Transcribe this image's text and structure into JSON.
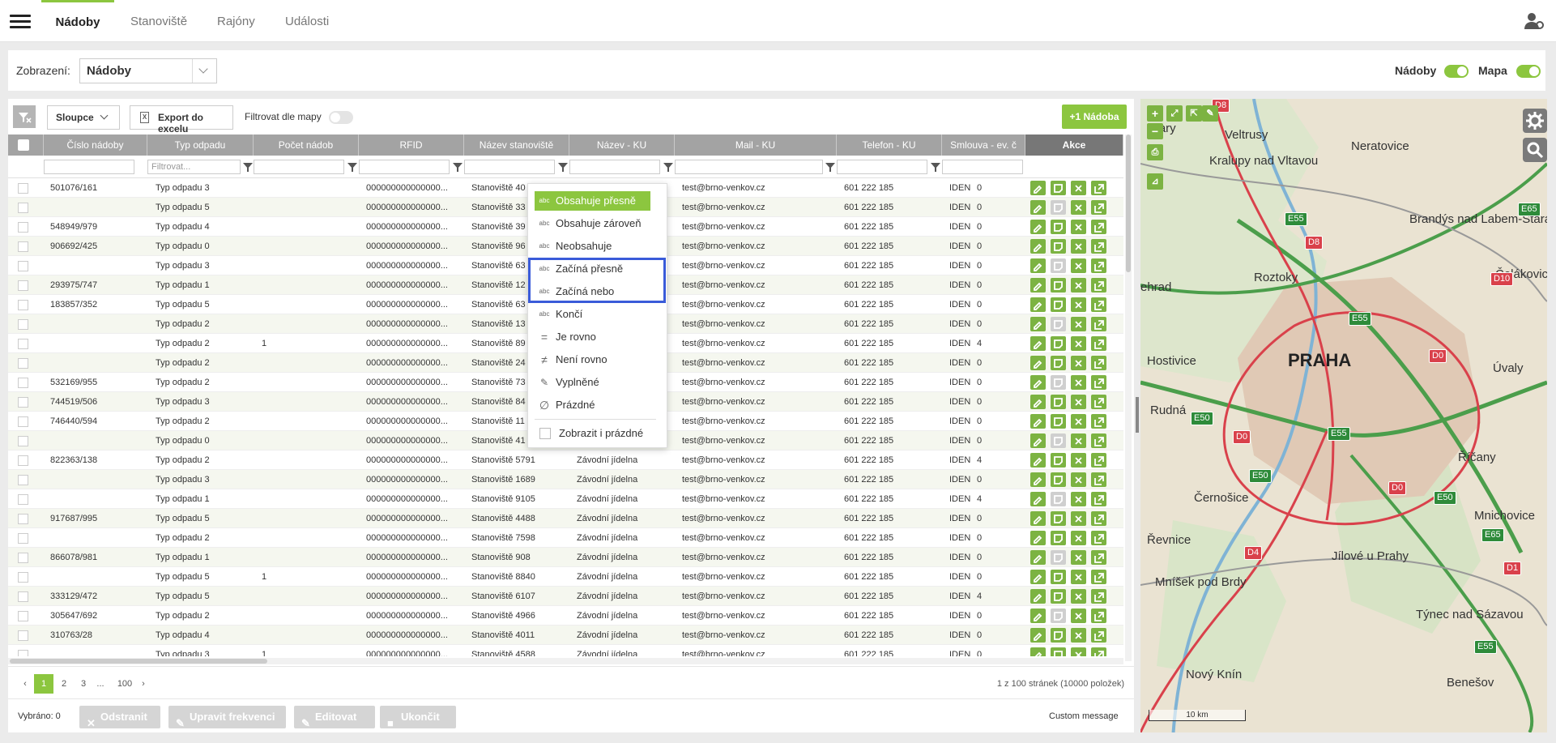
{
  "nav": {
    "tabs": [
      "Nádoby",
      "Stanoviště",
      "Rajóny",
      "Události"
    ]
  },
  "view": {
    "label": "Zobrazení:",
    "selected": "Nádoby",
    "toggle_nadoby": "Nádoby",
    "toggle_mapa": "Mapa"
  },
  "toolbar": {
    "columns": "Sloupce",
    "export": "Export do excelu",
    "filter_map": "Filtrovat dle mapy",
    "add": "+1 Nádoba"
  },
  "columns": [
    "Číslo nádoby",
    "Typ odpadu",
    "Počet nádob",
    "RFID",
    "Název stanoviště",
    "Název - KU",
    "Mail - KU",
    "Telefon - KU",
    "Smlouva - ev. č",
    "Akce"
  ],
  "filter_placeholder": "Filtrovat...",
  "rows": [
    {
      "cislo": "501076/161",
      "typ": "Typ odpadu 3",
      "pocet": "",
      "rfid": "000000000000000...",
      "stan": "Stanoviště 40",
      "ku": "",
      "mail": "test@brno-venkov.cz",
      "tel": "601 222 185",
      "sml": "IDEN",
      "n": "0"
    },
    {
      "cislo": "",
      "typ": "Typ odpadu 5",
      "pocet": "",
      "rfid": "000000000000000...",
      "stan": "Stanoviště 33",
      "ku": "",
      "mail": "test@brno-venkov.cz",
      "tel": "601 222 185",
      "sml": "IDEN",
      "n": "0"
    },
    {
      "cislo": "548949/979",
      "typ": "Typ odpadu 4",
      "pocet": "",
      "rfid": "000000000000000...",
      "stan": "Stanoviště 39",
      "ku": "",
      "mail": "test@brno-venkov.cz",
      "tel": "601 222 185",
      "sml": "IDEN",
      "n": "0"
    },
    {
      "cislo": "906692/425",
      "typ": "Typ odpadu 0",
      "pocet": "",
      "rfid": "000000000000000...",
      "stan": "Stanoviště 96",
      "ku": "",
      "mail": "test@brno-venkov.cz",
      "tel": "601 222 185",
      "sml": "IDEN",
      "n": "0"
    },
    {
      "cislo": "",
      "typ": "Typ odpadu 3",
      "pocet": "",
      "rfid": "000000000000000...",
      "stan": "Stanoviště 63",
      "ku": "",
      "mail": "test@brno-venkov.cz",
      "tel": "601 222 185",
      "sml": "IDEN",
      "n": "0"
    },
    {
      "cislo": "293975/747",
      "typ": "Typ odpadu 1",
      "pocet": "",
      "rfid": "000000000000000...",
      "stan": "Stanoviště 12",
      "ku": "",
      "mail": "test@brno-venkov.cz",
      "tel": "601 222 185",
      "sml": "IDEN",
      "n": "0"
    },
    {
      "cislo": "183857/352",
      "typ": "Typ odpadu 5",
      "pocet": "",
      "rfid": "000000000000000...",
      "stan": "Stanoviště 63",
      "ku": "",
      "mail": "test@brno-venkov.cz",
      "tel": "601 222 185",
      "sml": "IDEN",
      "n": "0"
    },
    {
      "cislo": "",
      "typ": "Typ odpadu 2",
      "pocet": "",
      "rfid": "000000000000000...",
      "stan": "Stanoviště 13",
      "ku": "",
      "mail": "test@brno-venkov.cz",
      "tel": "601 222 185",
      "sml": "IDEN",
      "n": "0"
    },
    {
      "cislo": "",
      "typ": "Typ odpadu 2",
      "pocet": "1",
      "rfid": "000000000000000...",
      "stan": "Stanoviště 89",
      "ku": "",
      "mail": "test@brno-venkov.cz",
      "tel": "601 222 185",
      "sml": "IDEN",
      "n": "4"
    },
    {
      "cislo": "",
      "typ": "Typ odpadu 2",
      "pocet": "",
      "rfid": "000000000000000...",
      "stan": "Stanoviště 24",
      "ku": "",
      "mail": "test@brno-venkov.cz",
      "tel": "601 222 185",
      "sml": "IDEN",
      "n": "0"
    },
    {
      "cislo": "532169/955",
      "typ": "Typ odpadu 2",
      "pocet": "",
      "rfid": "000000000000000...",
      "stan": "Stanoviště 73",
      "ku": "",
      "mail": "test@brno-venkov.cz",
      "tel": "601 222 185",
      "sml": "IDEN",
      "n": "0"
    },
    {
      "cislo": "744519/506",
      "typ": "Typ odpadu 3",
      "pocet": "",
      "rfid": "000000000000000...",
      "stan": "Stanoviště 84",
      "ku": "",
      "mail": "test@brno-venkov.cz",
      "tel": "601 222 185",
      "sml": "IDEN",
      "n": "0"
    },
    {
      "cislo": "746440/594",
      "typ": "Typ odpadu 2",
      "pocet": "",
      "rfid": "000000000000000...",
      "stan": "Stanoviště 11",
      "ku": "",
      "mail": "test@brno-venkov.cz",
      "tel": "601 222 185",
      "sml": "IDEN",
      "n": "0"
    },
    {
      "cislo": "",
      "typ": "Typ odpadu 0",
      "pocet": "",
      "rfid": "000000000000000...",
      "stan": "Stanoviště 41",
      "ku": "",
      "mail": "test@brno-venkov.cz",
      "tel": "601 222 185",
      "sml": "IDEN",
      "n": "0"
    },
    {
      "cislo": "822363/138",
      "typ": "Typ odpadu 2",
      "pocet": "",
      "rfid": "000000000000000...",
      "stan": "Stanoviště 5791",
      "ku": "Závodní jídelna",
      "mail": "test@brno-venkov.cz",
      "tel": "601 222 185",
      "sml": "IDEN",
      "n": "4"
    },
    {
      "cislo": "",
      "typ": "Typ odpadu 3",
      "pocet": "",
      "rfid": "000000000000000...",
      "stan": "Stanoviště 1689",
      "ku": "Závodní jídelna",
      "mail": "test@brno-venkov.cz",
      "tel": "601 222 185",
      "sml": "IDEN",
      "n": "0"
    },
    {
      "cislo": "",
      "typ": "Typ odpadu 1",
      "pocet": "",
      "rfid": "000000000000000...",
      "stan": "Stanoviště 9105",
      "ku": "Závodní jídelna",
      "mail": "test@brno-venkov.cz",
      "tel": "601 222 185",
      "sml": "IDEN",
      "n": "4"
    },
    {
      "cislo": "917687/995",
      "typ": "Typ odpadu 5",
      "pocet": "",
      "rfid": "000000000000000...",
      "stan": "Stanoviště 4488",
      "ku": "Závodní jídelna",
      "mail": "test@brno-venkov.cz",
      "tel": "601 222 185",
      "sml": "IDEN",
      "n": "0"
    },
    {
      "cislo": "",
      "typ": "Typ odpadu 2",
      "pocet": "",
      "rfid": "000000000000000...",
      "stan": "Stanoviště 7598",
      "ku": "Závodní jídelna",
      "mail": "test@brno-venkov.cz",
      "tel": "601 222 185",
      "sml": "IDEN",
      "n": "0"
    },
    {
      "cislo": "866078/981",
      "typ": "Typ odpadu 1",
      "pocet": "",
      "rfid": "000000000000000...",
      "stan": "Stanoviště 908",
      "ku": "Závodní jídelna",
      "mail": "test@brno-venkov.cz",
      "tel": "601 222 185",
      "sml": "IDEN",
      "n": "0"
    },
    {
      "cislo": "",
      "typ": "Typ odpadu 5",
      "pocet": "1",
      "rfid": "000000000000000...",
      "stan": "Stanoviště 8840",
      "ku": "Závodní jídelna",
      "mail": "test@brno-venkov.cz",
      "tel": "601 222 185",
      "sml": "IDEN",
      "n": "0"
    },
    {
      "cislo": "333129/472",
      "typ": "Typ odpadu 5",
      "pocet": "",
      "rfid": "000000000000000...",
      "stan": "Stanoviště 6107",
      "ku": "Závodní jídelna",
      "mail": "test@brno-venkov.cz",
      "tel": "601 222 185",
      "sml": "IDEN",
      "n": "4"
    },
    {
      "cislo": "305647/692",
      "typ": "Typ odpadu 2",
      "pocet": "",
      "rfid": "000000000000000...",
      "stan": "Stanoviště 4966",
      "ku": "Závodní jídelna",
      "mail": "test@brno-venkov.cz",
      "tel": "601 222 185",
      "sml": "IDEN",
      "n": "0"
    },
    {
      "cislo": "310763/28",
      "typ": "Typ odpadu 4",
      "pocet": "",
      "rfid": "000000000000000...",
      "stan": "Stanoviště 4011",
      "ku": "Závodní jídelna",
      "mail": "test@brno-venkov.cz",
      "tel": "601 222 185",
      "sml": "IDEN",
      "n": "0"
    },
    {
      "cislo": "",
      "typ": "Typ odpadu 3",
      "pocet": "1",
      "rfid": "000000000000000...",
      "stan": "Stanoviště 4588",
      "ku": "Závodní jídelna",
      "mail": "test@brno-venkov.cz",
      "tel": "601 222 185",
      "sml": "IDEN",
      "n": "0"
    }
  ],
  "filter_menu": {
    "items": [
      "Obsahuje přesně",
      "Obsahuje zároveň",
      "Neobsahuje",
      "Začíná přesně",
      "Začíná nebo",
      "Končí",
      "Je rovno",
      "Není rovno",
      "Vyplněné",
      "Prázdné"
    ],
    "show_empty": "Zobrazit i prázdné"
  },
  "pager": {
    "pages": [
      "1",
      "2",
      "3",
      "...",
      "100"
    ],
    "summary": "1 z 100 stránek (10000 položek)"
  },
  "footer": {
    "selected": "Vybráno: 0",
    "remove": "Odstranit",
    "freq": "Upravit frekvenci",
    "edit": "Editovat",
    "end": "Ukončit",
    "custom": "Custom message"
  },
  "map": {
    "places": [
      "Kralupy nad Vltavou",
      "Veltrusy",
      "Neratovice",
      "Brandýs nad Labem-Stará Boleslav",
      "Roztoky",
      "Čelákovic",
      "ehrad",
      "Hostivice",
      "PRAHA",
      "Úvaly",
      "Rudná",
      "Říčany",
      "Černošice",
      "Mnichovice",
      "Řevnice",
      "Jílové u Prahy",
      "Mníšek pod Brdy",
      "Týnec nad Sázavou",
      "Nový Knín",
      "Benešov",
      "lvary"
    ],
    "roads": [
      "E55",
      "D8",
      "E65",
      "D10",
      "E55",
      "D0",
      "E50",
      "D0",
      "E55",
      "E50",
      "D0",
      "E50",
      "D4",
      "E65",
      "D1",
      "E55",
      "D8"
    ],
    "scale": "10 km"
  }
}
